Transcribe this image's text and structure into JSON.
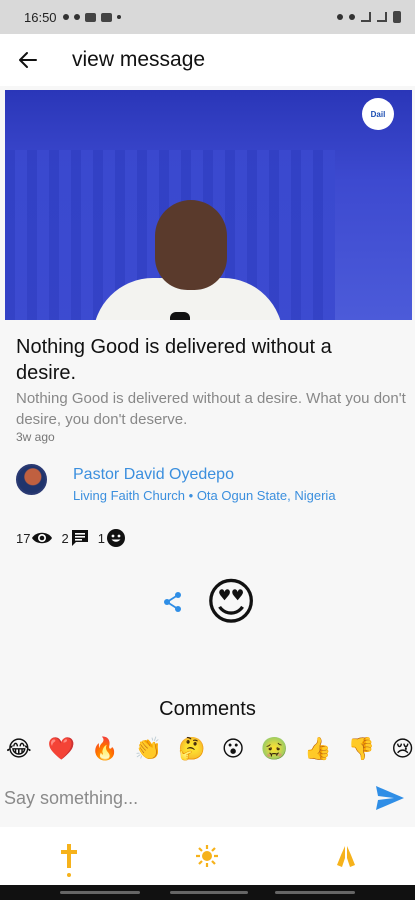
{
  "status_bar": {
    "time": "16:50"
  },
  "app_bar": {
    "title": "view message",
    "back_icon": "arrow-left-icon"
  },
  "hero": {
    "logo_text": "Dail"
  },
  "message": {
    "title": "Nothing Good is delivered without a desire.",
    "body": "Nothing Good is delivered without a desire. What you don't desire, you don't deserve.",
    "time": "3w ago"
  },
  "author": {
    "name": "Pastor David Oyedepo",
    "church": "Living Faith Church",
    "separator": "•",
    "location": "Ota Ogun State, Nigeria"
  },
  "stats": {
    "views": "17",
    "comments": "2",
    "reactions": "1"
  },
  "reaction_emoji": "😍",
  "comments": {
    "label": "Comments",
    "emojis": [
      "😂",
      "❤️",
      "🔥",
      "👏",
      "🤔",
      "😮",
      "🤢",
      "👍",
      "👎",
      "😢"
    ],
    "placeholder": "Say something..."
  },
  "colors": {
    "accent": "#3b8fde",
    "nav": "#f6b21b",
    "send": "#2f8ee6"
  }
}
